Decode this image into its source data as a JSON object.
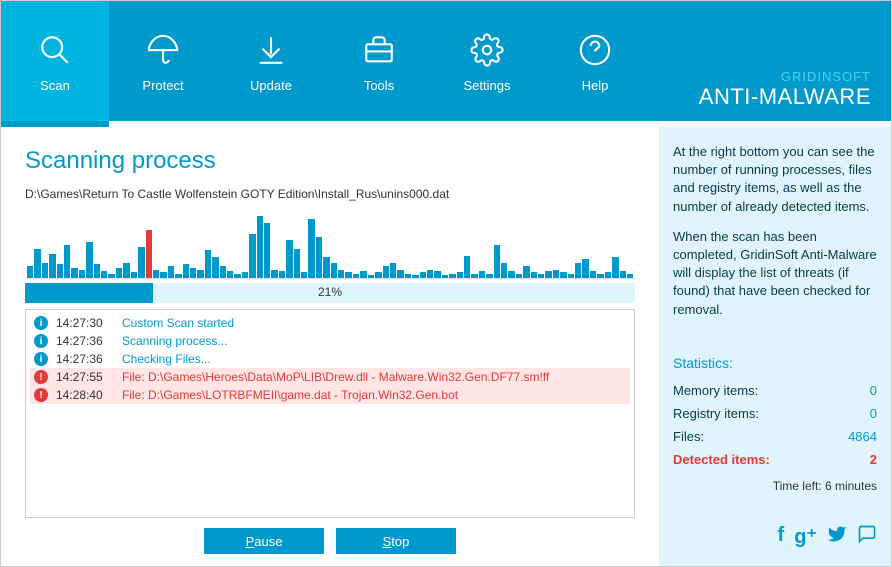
{
  "brand": {
    "top": "GRIDINSOFT",
    "bottom": "ANTI-MALWARE"
  },
  "nav": [
    {
      "label": "Scan",
      "icon": "magnify",
      "active": true
    },
    {
      "label": "Protect",
      "icon": "umbrella",
      "active": false
    },
    {
      "label": "Update",
      "icon": "download",
      "active": false
    },
    {
      "label": "Tools",
      "icon": "briefcase",
      "active": false
    },
    {
      "label": "Settings",
      "icon": "gear",
      "active": false
    },
    {
      "label": "Help",
      "icon": "help",
      "active": false
    }
  ],
  "main": {
    "title": "Scanning process",
    "current_file": "D:\\Games\\Return To Castle Wolfenstein GOTY Edition\\Install_Rus\\unins000.dat",
    "progress_percent": "21%",
    "progress_width": 21,
    "buttons": {
      "pause": "Pause",
      "stop": "Stop"
    }
  },
  "log": [
    {
      "type": "info",
      "time": "14:27:30",
      "msg": "Custom Scan started"
    },
    {
      "type": "info",
      "time": "14:27:36",
      "msg": "Scanning process..."
    },
    {
      "type": "info",
      "time": "14:27:36",
      "msg": "Checking Files..."
    },
    {
      "type": "warn",
      "time": "14:27:55",
      "msg": "File: D:\\Games\\Heroes\\Data\\MoP\\LIB\\Drew.dll - Malware.Win32.Gen.DF77.sm!ff"
    },
    {
      "type": "warn",
      "time": "14:28:40",
      "msg": "File: D:\\Games\\LOTRBFMEII\\game.dat - Trojan.Win32.Gen.bot"
    }
  ],
  "sidebar": {
    "para1": "At the right bottom you can see the number of running processes, files and registry items, as well as the number of already detected items.",
    "para2": "When the scan has been completed, GridinSoft Anti-Malware will display the list of threats (if found) that have been checked for removal.",
    "stats_title": "Statistics:",
    "stats": {
      "memory_label": "Memory items:",
      "memory_val": "0",
      "registry_label": "Registry items:",
      "registry_val": "0",
      "files_label": "Files:",
      "files_val": "4864",
      "detected_label": "Detected items:",
      "detected_val": "2"
    },
    "time_left": "Time left: 6 minutes"
  },
  "chart_data": {
    "type": "bar",
    "title": "Scan activity",
    "values": [
      18,
      42,
      22,
      35,
      20,
      48,
      14,
      12,
      52,
      20,
      10,
      6,
      15,
      22,
      8,
      45,
      70,
      12,
      9,
      18,
      6,
      20,
      14,
      12,
      40,
      30,
      18,
      10,
      6,
      8,
      64,
      90,
      80,
      12,
      10,
      55,
      42,
      8,
      85,
      60,
      30,
      22,
      12,
      8,
      6,
      10,
      4,
      8,
      18,
      22,
      12,
      6,
      4,
      8,
      12,
      10,
      4,
      6,
      8,
      32,
      6,
      10,
      6,
      48,
      22,
      10,
      6,
      18,
      8,
      6,
      10,
      12,
      8,
      6,
      22,
      28,
      10,
      6,
      8,
      30,
      10,
      6
    ],
    "alert_index": 16,
    "ylim": [
      0,
      100
    ]
  }
}
